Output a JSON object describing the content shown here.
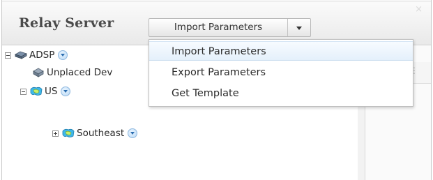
{
  "header": {
    "title": "Relay Server",
    "split_button": {
      "label": "Import Parameters"
    }
  },
  "menu": {
    "items": [
      {
        "label": "Import Parameters"
      },
      {
        "label": "Export Parameters"
      },
      {
        "label": "Get Template"
      }
    ]
  },
  "tree": {
    "nodes": [
      {
        "label": "ADSP"
      },
      {
        "label": "Unplaced Dev"
      },
      {
        "label": "US"
      },
      {
        "label": "Southeast"
      }
    ]
  },
  "colors": {
    "accent": "#2a6db0",
    "title_text": "#4a4a4a",
    "menu_hover": "#e4f0fb"
  },
  "icons": {
    "adsp": "server-icon",
    "unplaced": "device-icon",
    "us": "region-icon",
    "southeast": "region-icon"
  }
}
